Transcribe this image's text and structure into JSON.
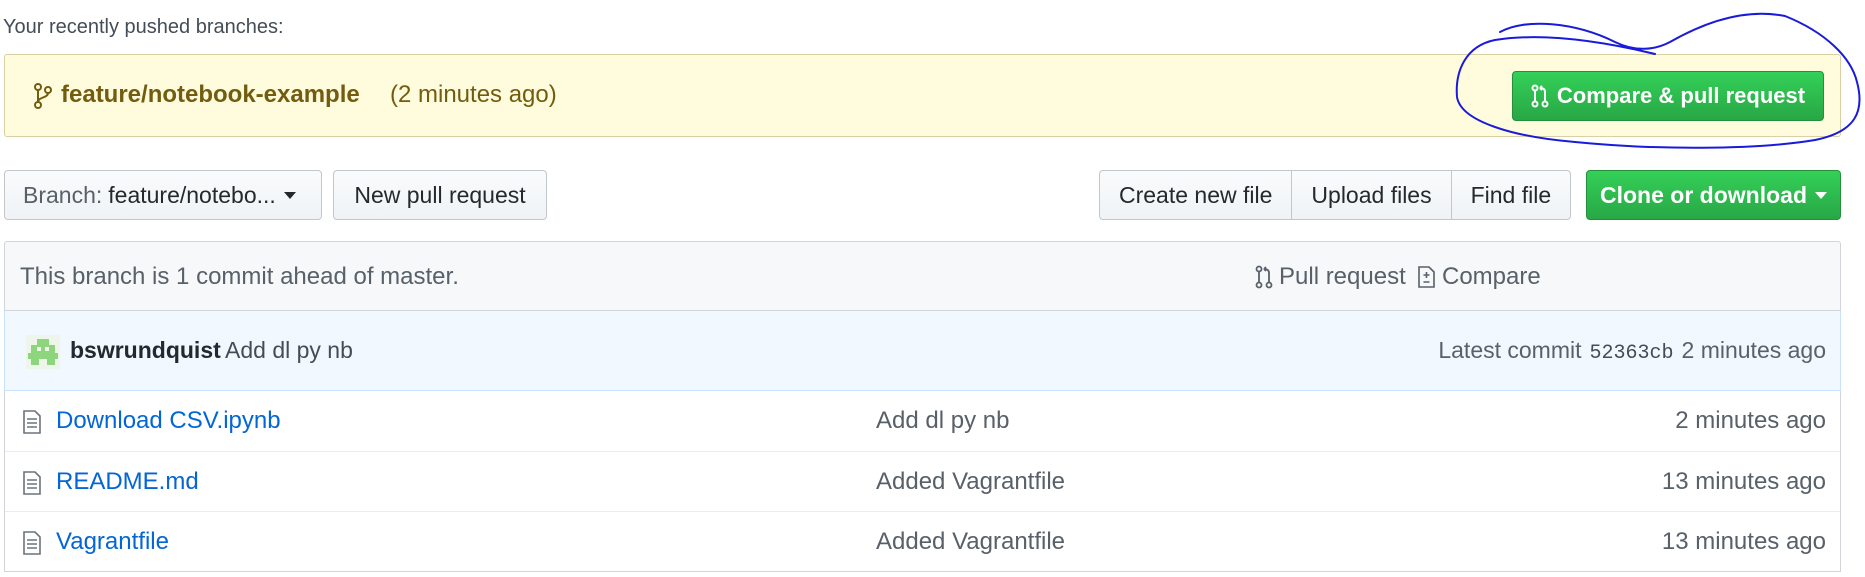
{
  "recent": {
    "label": "Your recently pushed branches:",
    "branch": "feature/notebook-example",
    "time": "(2 minutes ago)",
    "compare_button": "Compare & pull request"
  },
  "toolbar": {
    "branch_prefix": "Branch:",
    "branch_name": "feature/notebo...",
    "new_pr": "New pull request",
    "create_file": "Create new file",
    "upload_files": "Upload files",
    "find_file": "Find file",
    "clone": "Clone or download"
  },
  "branch_info": {
    "status": "This branch is 1 commit ahead of master.",
    "pull_request": "Pull request",
    "compare": "Compare"
  },
  "commit": {
    "author": "bswrundquist",
    "message": "Add dl py nb",
    "latest_label": "Latest commit",
    "sha": "52363cb",
    "time": "2 minutes ago"
  },
  "files": [
    {
      "name": "Download CSV.ipynb",
      "message": "Add dl py nb",
      "age": "2 minutes ago"
    },
    {
      "name": "README.md",
      "message": "Added Vagrantfile",
      "age": "13 minutes ago"
    },
    {
      "name": "Vagrantfile",
      "message": "Added Vagrantfile",
      "age": "13 minutes ago"
    }
  ],
  "colors": {
    "green": "#28a745",
    "link": "#0366d6",
    "banner": "#fffbdd",
    "annotation": "#1a1adb"
  },
  "icons": {
    "branch": "git-branch-icon",
    "pull_request": "git-pull-request-icon",
    "compare": "diff-icon",
    "file": "file-text-icon",
    "avatar": "identicon-avatar"
  }
}
